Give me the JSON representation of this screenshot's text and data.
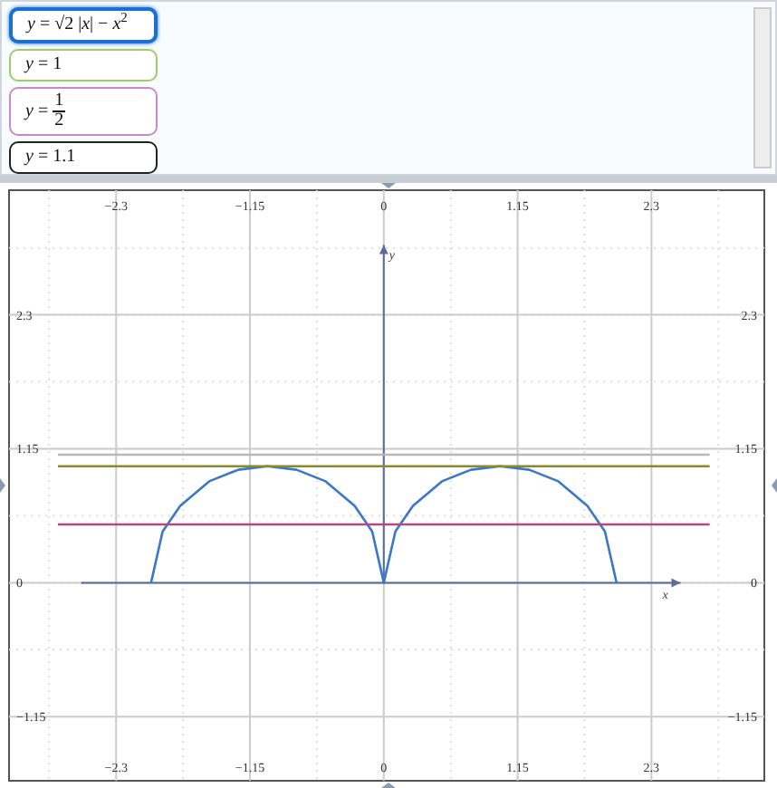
{
  "equations": [
    {
      "kind": "text",
      "text": "*y* = √2 |*x*| − *x*$^{2}$",
      "color": "#1a6fd0",
      "selected": true
    },
    {
      "kind": "text",
      "text": "*y* = 1",
      "color": "#9ccc6a",
      "selected": false
    },
    {
      "kind": "fraction",
      "lhs": "*y* =",
      "numerator": "1",
      "denominator": "2",
      "color": "#c78ac8",
      "selected": false
    },
    {
      "kind": "text",
      "text": "*y* = 1.1",
      "color": "#222222",
      "selected": false
    }
  ],
  "graph": {
    "chart_data": {
      "type": "line",
      "xlabel": "x",
      "ylabel": "y",
      "x": [
        -2.8,
        -2,
        -1.9,
        -1.75,
        -1.5,
        -1.25,
        -1,
        -0.75,
        -0.5,
        -0.25,
        -0.1,
        0,
        0.1,
        0.25,
        0.5,
        0.75,
        1,
        1.25,
        1.5,
        1.75,
        1.9,
        2,
        2.8
      ],
      "series": [
        {
          "color": "#3a78c4",
          "values": [
            null,
            0,
            0.44,
            0.66,
            0.87,
            0.97,
            1,
            0.97,
            0.87,
            0.66,
            0.44,
            0,
            0.44,
            0.66,
            0.87,
            0.97,
            1,
            0.97,
            0.87,
            0.66,
            0.44,
            0,
            null
          ]
        },
        {
          "color": "#8a8a2a",
          "values": [
            1,
            1,
            1,
            1,
            1,
            1,
            1,
            1,
            1,
            1,
            1,
            1,
            1,
            1,
            1,
            1,
            1,
            1,
            1,
            1,
            1,
            1,
            1
          ]
        },
        {
          "color": "#b04a80",
          "values": [
            0.5,
            0.5,
            0.5,
            0.5,
            0.5,
            0.5,
            0.5,
            0.5,
            0.5,
            0.5,
            0.5,
            0.5,
            0.5,
            0.5,
            0.5,
            0.5,
            0.5,
            0.5,
            0.5,
            0.5,
            0.5,
            0.5,
            0.5
          ]
        },
        {
          "color": "#b8b8b8",
          "values": [
            1.1,
            1.1,
            1.1,
            1.1,
            1.1,
            1.1,
            1.1,
            1.1,
            1.1,
            1.1,
            1.1,
            1.1,
            1.1,
            1.1,
            1.1,
            1.1,
            1.1,
            1.1,
            1.1,
            1.1,
            1.1,
            1.1,
            1.1
          ]
        }
      ],
      "grid": true,
      "xlim": [
        -3.22,
        3.27
      ],
      "ylim": [
        -1.7,
        3.37
      ],
      "xticks": [
        {
          "value": -2.3,
          "label": "−2.3"
        },
        {
          "value": -1.15,
          "label": "−1.15"
        },
        {
          "value": 0,
          "label": "0"
        },
        {
          "value": 1.15,
          "label": "1.15"
        },
        {
          "value": 2.3,
          "label": "2.3"
        }
      ],
      "yticks": [
        {
          "value": -1.15,
          "label": "−1.15"
        },
        {
          "value": 0,
          "label": "0"
        },
        {
          "value": 1.15,
          "label": "1.15"
        },
        {
          "value": 2.3,
          "label": "2.3"
        }
      ]
    }
  }
}
